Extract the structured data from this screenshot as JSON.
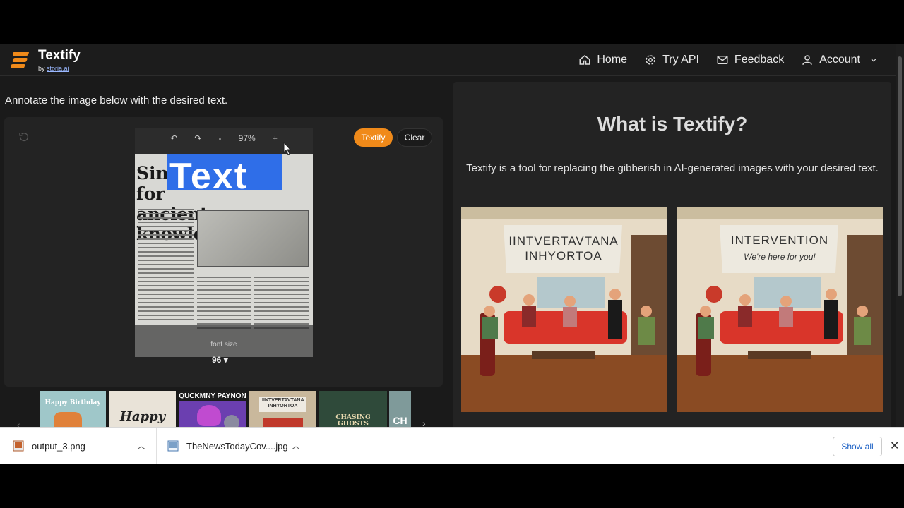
{
  "header": {
    "brand": "Textify",
    "by_prefix": "by ",
    "by_link": "storia.ai",
    "nav": [
      {
        "label": "Home",
        "icon": "home-icon"
      },
      {
        "label": "Try API",
        "icon": "gear-icon"
      },
      {
        "label": "Feedback",
        "icon": "mail-icon"
      },
      {
        "label": "Account",
        "icon": "user-icon"
      }
    ]
  },
  "editor": {
    "instruction": "Annotate the image below with the desired text.",
    "zoom": "97%",
    "zoom_minus": "-",
    "zoom_plus": "+",
    "headline_line1": "Sing the quest for",
    "headline_line2": "ancient knowledge",
    "annotation_text": "Text",
    "font_size_label": "font size",
    "font_size_value": "96",
    "textify_button": "Textify",
    "clear_button": "Clear"
  },
  "thumbnails": [
    {
      "text": "Happy Birthday",
      "color": "#9fc7c9"
    },
    {
      "text": "Happy",
      "color": "#e9e3d8"
    },
    {
      "text": "QUCKMNY PAYNON",
      "color": "#6b3fb0"
    },
    {
      "text": "IINTVERTAVTANA INHYORTOA",
      "color": "#c9b89c"
    },
    {
      "text": "CHASING GHOSTS",
      "color": "#2f4a3a"
    },
    {
      "text": "CH",
      "color": "#7f9a9a"
    }
  ],
  "info": {
    "title": "What is Textify?",
    "description": "Textify is a tool for replacing the gibberish in AI-generated images with your desired text.",
    "before_banner": [
      "IINTVERTAVTANA",
      "INHYORTOA"
    ],
    "after_banner": [
      "INTERVENTION",
      "We're here for you!"
    ]
  },
  "downloads": [
    {
      "filename": "output_3.png",
      "icon": "image-file-icon"
    },
    {
      "filename": "TheNewsTodayCov....jpg",
      "icon": "image-file-icon"
    }
  ],
  "downloads_show_all": "Show all",
  "colors": {
    "accent": "#f08a1a",
    "selection": "#2f6ee8",
    "background": "#1a1a1a"
  }
}
